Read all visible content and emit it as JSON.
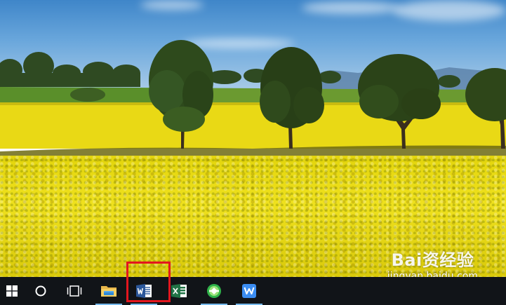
{
  "screen": {
    "kind": "Windows 10 desktop with taskbar"
  },
  "watermark": {
    "logo": "Bai资经验",
    "url": "jingyan.baidu.com"
  },
  "taskbar": {
    "items": [
      {
        "icon": "windows-start-icon",
        "pinned": true,
        "running": false
      },
      {
        "icon": "cortana-search-icon",
        "pinned": true,
        "running": false
      },
      {
        "icon": "task-view-icon",
        "pinned": true,
        "running": false
      },
      {
        "icon": "file-explorer-icon",
        "pinned": true,
        "running": true
      },
      {
        "icon": "word-icon",
        "pinned": true,
        "running": true,
        "highlighted": true
      },
      {
        "icon": "excel-icon",
        "pinned": true,
        "running": false
      },
      {
        "icon": "green-browser-icon",
        "pinned": true,
        "running": true
      },
      {
        "icon": "wps-icon",
        "pinned": true,
        "running": true
      }
    ]
  },
  "colors": {
    "taskbar": "#111418",
    "highlight": "#e3161e",
    "running_indicator": "#76b9ed",
    "word_blue": "#2b579a",
    "excel_green": "#217346",
    "field_yellow": "#e8d814"
  }
}
